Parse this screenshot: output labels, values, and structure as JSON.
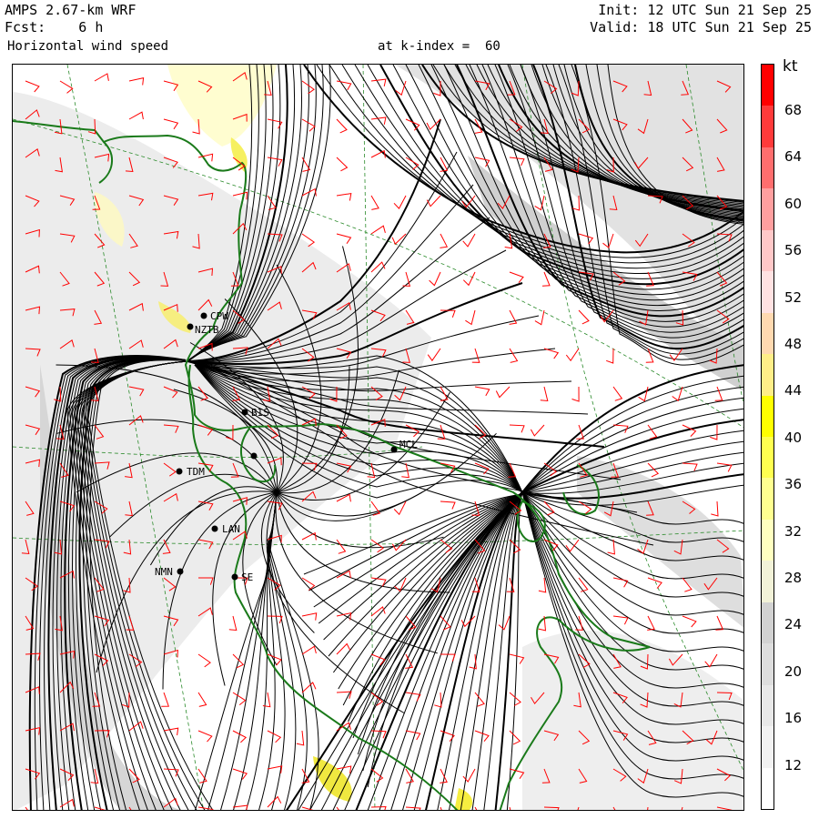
{
  "header": {
    "model": "AMPS 2.67-km WRF",
    "forecast": "Fcst:    6 h",
    "field": "Horizontal wind speed",
    "level": "at k-index =  60",
    "init": "Init: 12 UTC Sun 21 Sep 25",
    "valid": "Valid: 18 UTC Sun 21 Sep 25"
  },
  "colorbar": {
    "unit": "kt",
    "labels": [
      "68",
      "64",
      "60",
      "56",
      "52",
      "48",
      "44",
      "40",
      "36",
      "32",
      "28",
      "24",
      "20",
      "16",
      "12"
    ],
    "colors": [
      "#ff0000",
      "#ff3a3a",
      "#ff6e6e",
      "#ff9f9f",
      "#ffc8c8",
      "#ffe2e2",
      "#ffd9b0",
      "#ffee88",
      "#ffff00",
      "#ffff50",
      "#ffff90",
      "#ffffc0",
      "#f2f2d8",
      "#d2d2d2",
      "#dddddd",
      "#e8e8e8",
      "#f2f2f2",
      "#ffffff"
    ]
  },
  "stations": [
    "CPW",
    "NZTB",
    "BIS",
    "TDM",
    "LAN",
    "NMN",
    "SE",
    "MCL"
  ],
  "colors": {
    "coast": "#1a7a1a",
    "barbs": "#ff0000",
    "streamlines": "#000000",
    "grid": "#2a8a2a"
  }
}
